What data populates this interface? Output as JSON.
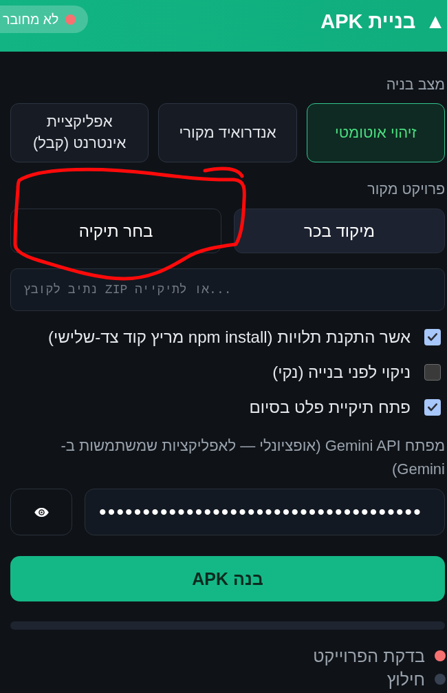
{
  "header": {
    "toggle": "▲",
    "title": "בניית APK",
    "status": {
      "label": "לא מחובר",
      "color": "#f87171"
    }
  },
  "build_mode": {
    "label": "מצב בניה",
    "options": [
      {
        "label": "זיהוי אוטומטי",
        "selected": true
      },
      {
        "label": "אנדרואיד מקורי",
        "selected": false
      },
      {
        "label": "אפליקציית אינטרנט (קבל)",
        "selected": false
      }
    ]
  },
  "source": {
    "label": "פרויקט מקור",
    "options": [
      {
        "label": "מיקוד בכר",
        "selected": true
      },
      {
        "label": "בחר תיקיה",
        "selected": false
      }
    ],
    "path_field": {
      "placeholder": "נתיב לקובץ ZIP או לתיקייה..."
    }
  },
  "options": [
    {
      "label": "אשר התקנת תלויות (npm install מריץ קוד צד-שלישי)",
      "checked": true
    },
    {
      "label": "ניקוי לפני בנייה (נקי)",
      "checked": false
    },
    {
      "label": "פתח תיקיית פלט בסיום",
      "checked": true
    }
  ],
  "api_key": {
    "label": "מפתח Gemini API (אופציונלי — לאפליקציות שמשתמשות ב-Gemini)",
    "value": "•••••••••••••••••••••••••••••••••••••"
  },
  "build_button": "בנה APK",
  "progress": {
    "level": 0
  },
  "steps": [
    {
      "label": "בדקת הפרוייקט",
      "color": "#f87171"
    },
    {
      "label": "חילוץ",
      "color": "#374151"
    }
  ],
  "annotations": [
    {
      "kind": "freehand_loop"
    }
  ]
}
